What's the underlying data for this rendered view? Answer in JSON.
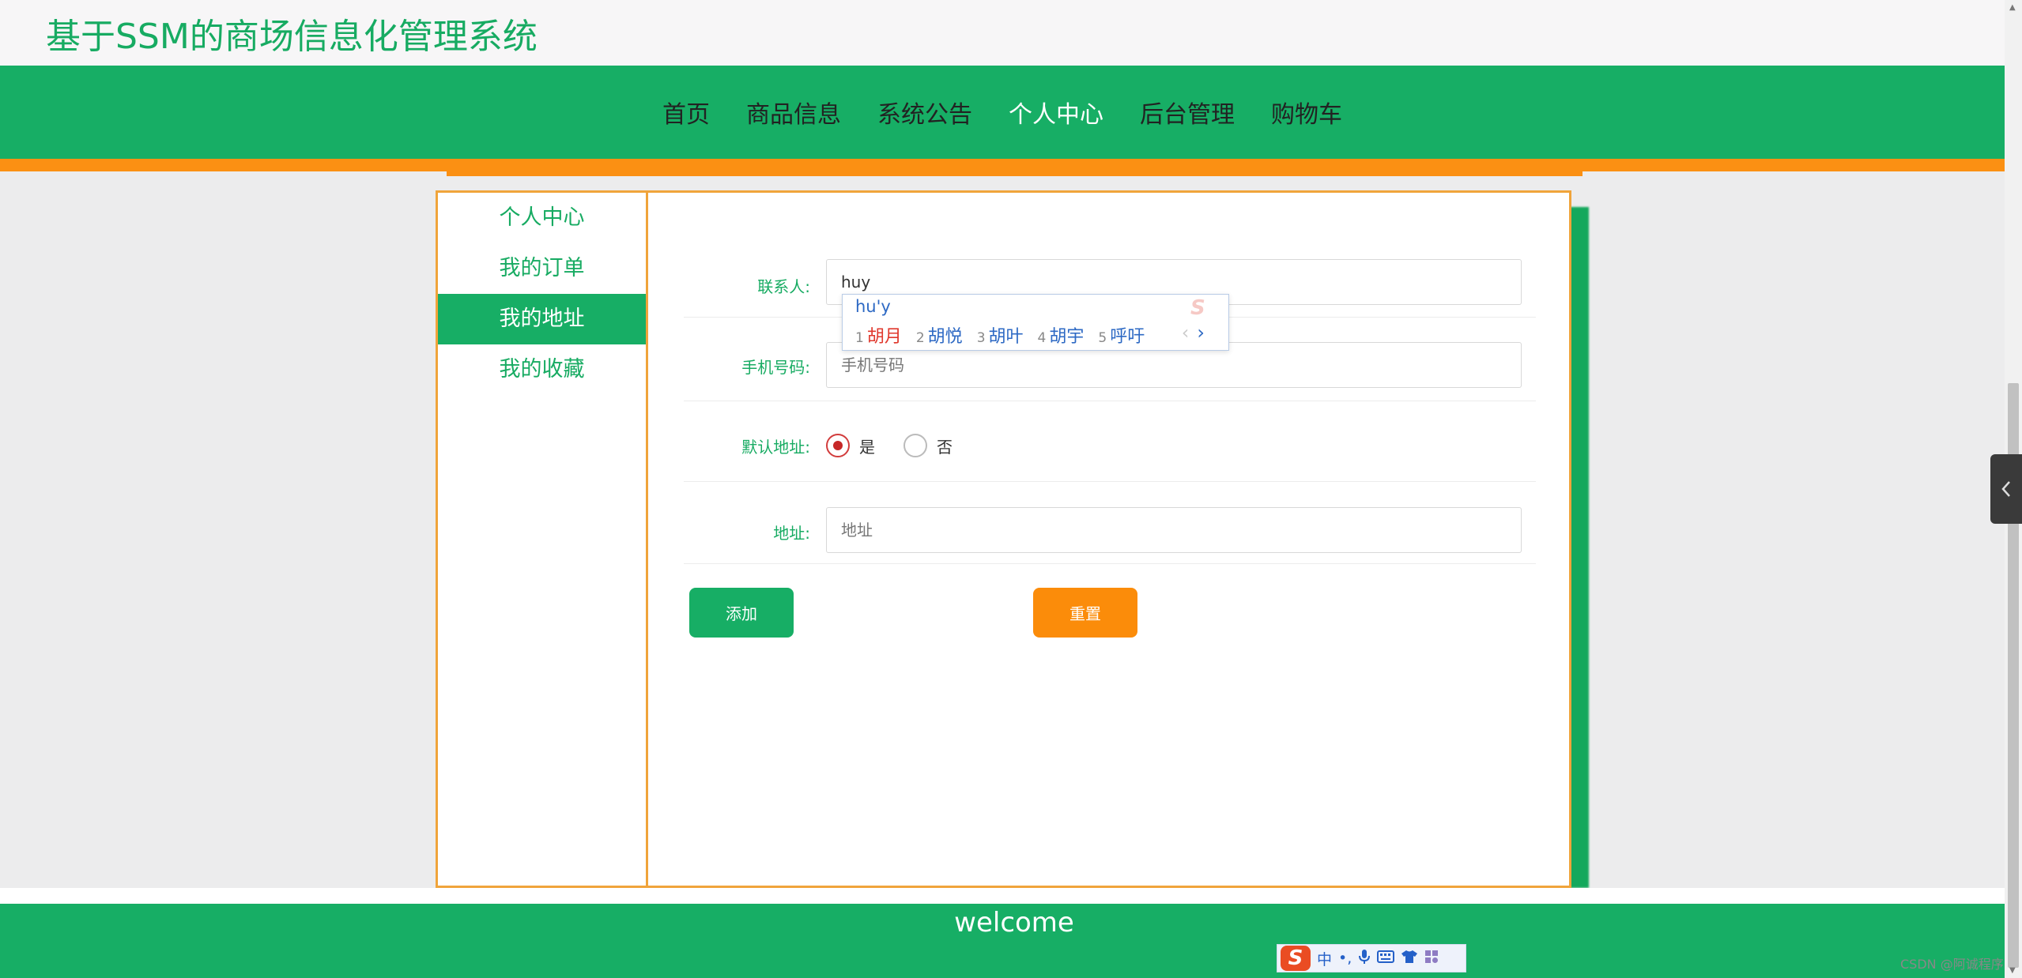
{
  "header": {
    "title": "基于SSM的商场信息化管理系统"
  },
  "nav": {
    "items": [
      {
        "label": "首页",
        "active": false
      },
      {
        "label": "商品信息",
        "active": false
      },
      {
        "label": "系统公告",
        "active": false
      },
      {
        "label": "个人中心",
        "active": true
      },
      {
        "label": "后台管理",
        "active": false
      },
      {
        "label": "购物车",
        "active": false
      }
    ]
  },
  "sidebar": {
    "items": [
      {
        "label": "个人中心",
        "active": false
      },
      {
        "label": "我的订单",
        "active": false
      },
      {
        "label": "我的地址",
        "active": true
      },
      {
        "label": "我的收藏",
        "active": false
      }
    ]
  },
  "form": {
    "contact": {
      "label": "联系人:",
      "value": "huy"
    },
    "phone": {
      "label": "手机号码:",
      "placeholder": "手机号码"
    },
    "default_address": {
      "label": "默认地址:",
      "options": [
        "是",
        "否"
      ],
      "selected": "是"
    },
    "address": {
      "label": "地址:",
      "placeholder": "地址"
    },
    "add_label": "添加",
    "reset_label": "重置"
  },
  "ime_popup": {
    "pinyin": "hu'y",
    "candidates": [
      {
        "num": "1",
        "text": "胡月"
      },
      {
        "num": "2",
        "text": "胡悦"
      },
      {
        "num": "3",
        "text": "胡叶"
      },
      {
        "num": "4",
        "text": "胡宇"
      },
      {
        "num": "5",
        "text": "呼吁"
      }
    ],
    "prev": "‹",
    "next": "›",
    "logo": "S"
  },
  "ime_toolbar": {
    "logo": "S",
    "mode": "中",
    "punct": "•,",
    "voice_icon": "mic-icon",
    "keyboard_icon": "keyboard-icon",
    "skin_icon": "shirt-icon",
    "apps_icon": "grid-icon"
  },
  "footer": {
    "text": "welcome"
  },
  "watermark": "CSDN @阿诚程序",
  "colors": {
    "primary": "#17ae65",
    "accent": "#fb9013",
    "panel_border": "#f0a43b"
  }
}
